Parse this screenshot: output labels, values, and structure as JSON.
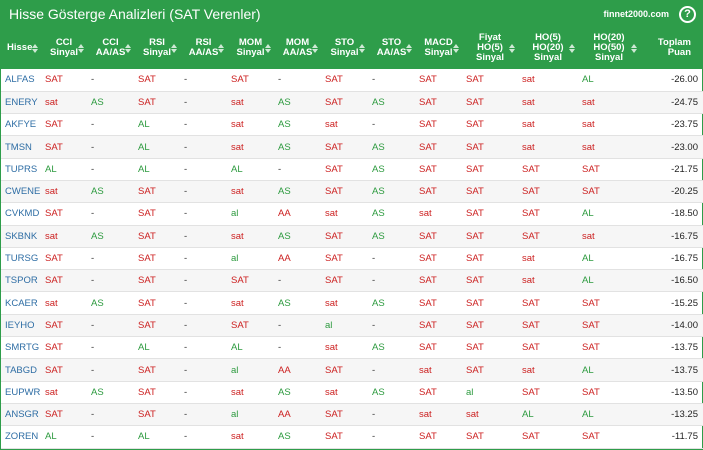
{
  "header": {
    "title": "Hisse Gösterge Analizleri (SAT Verenler)",
    "brand": "finnet2000.com",
    "help": "?"
  },
  "colors": {
    "accent": "#2e9d4a",
    "sell": "#cc1f1f",
    "buy": "#2c9a3e",
    "link": "#2e6da4"
  },
  "columns": [
    {
      "key": "hisse",
      "lines": [
        "Hisse"
      ]
    },
    {
      "key": "cci",
      "lines": [
        "CCI",
        "Sinyal"
      ]
    },
    {
      "key": "cci_aa",
      "lines": [
        "CCI",
        "AA/AS"
      ]
    },
    {
      "key": "rsi",
      "lines": [
        "RSI",
        "Sinyal"
      ]
    },
    {
      "key": "rsi_aa",
      "lines": [
        "RSI",
        "AA/AS"
      ]
    },
    {
      "key": "mom",
      "lines": [
        "MOM",
        "Sinyal"
      ]
    },
    {
      "key": "mom_aa",
      "lines": [
        "MOM",
        "AA/AS"
      ]
    },
    {
      "key": "sto",
      "lines": [
        "STO",
        "Sinyal"
      ]
    },
    {
      "key": "sto_aa",
      "lines": [
        "STO",
        "AA/AS"
      ]
    },
    {
      "key": "macd",
      "lines": [
        "MACD",
        "Sinyal"
      ]
    },
    {
      "key": "fiyat_ho5",
      "lines": [
        "Fiyat",
        "HO(5)",
        "Sinyal"
      ]
    },
    {
      "key": "ho5_20",
      "lines": [
        "HO(5)",
        "HO(20)",
        "Sinyal"
      ]
    },
    {
      "key": "ho20_50",
      "lines": [
        "HO(20)",
        "HO(50)",
        "Sinyal"
      ]
    },
    {
      "key": "puan",
      "lines": [
        "Toplam",
        "Puan"
      ]
    }
  ],
  "rows": [
    [
      "ALFAS",
      "SAT",
      "-",
      "SAT",
      "-",
      "SAT",
      "-",
      "SAT",
      "-",
      "SAT",
      "SAT",
      "sat",
      "AL",
      "-26.00"
    ],
    [
      "ENERY",
      "sat",
      "AS",
      "SAT",
      "-",
      "sat",
      "AS",
      "SAT",
      "AS",
      "SAT",
      "SAT",
      "sat",
      "sat",
      "-24.75"
    ],
    [
      "AKFYE",
      "SAT",
      "-",
      "AL",
      "-",
      "sat",
      "AS",
      "sat",
      "-",
      "SAT",
      "SAT",
      "sat",
      "sat",
      "-23.75"
    ],
    [
      "TMSN",
      "SAT",
      "-",
      "AL",
      "-",
      "sat",
      "AS",
      "SAT",
      "AS",
      "SAT",
      "SAT",
      "sat",
      "sat",
      "-23.00"
    ],
    [
      "TUPRS",
      "AL",
      "-",
      "AL",
      "-",
      "AL",
      "-",
      "SAT",
      "AS",
      "SAT",
      "SAT",
      "SAT",
      "SAT",
      "-21.75"
    ],
    [
      "CWENE",
      "sat",
      "AS",
      "SAT",
      "-",
      "sat",
      "AS",
      "SAT",
      "AS",
      "SAT",
      "SAT",
      "SAT",
      "SAT",
      "-20.25"
    ],
    [
      "CVKMD",
      "SAT",
      "-",
      "SAT",
      "-",
      "al",
      "AA",
      "sat",
      "AS",
      "sat",
      "SAT",
      "SAT",
      "AL",
      "-18.50"
    ],
    [
      "SKBNK",
      "sat",
      "AS",
      "SAT",
      "-",
      "sat",
      "AS",
      "SAT",
      "AS",
      "SAT",
      "SAT",
      "SAT",
      "sat",
      "-16.75"
    ],
    [
      "TURSG",
      "SAT",
      "-",
      "SAT",
      "-",
      "al",
      "AA",
      "SAT",
      "-",
      "SAT",
      "SAT",
      "sat",
      "AL",
      "-16.75"
    ],
    [
      "TSPOR",
      "SAT",
      "-",
      "SAT",
      "-",
      "SAT",
      "-",
      "SAT",
      "-",
      "SAT",
      "SAT",
      "sat",
      "AL",
      "-16.50"
    ],
    [
      "KCAER",
      "sat",
      "AS",
      "SAT",
      "-",
      "sat",
      "AS",
      "sat",
      "AS",
      "SAT",
      "SAT",
      "SAT",
      "SAT",
      "-15.25"
    ],
    [
      "IEYHO",
      "SAT",
      "-",
      "SAT",
      "-",
      "SAT",
      "-",
      "al",
      "-",
      "SAT",
      "SAT",
      "SAT",
      "SAT",
      "-14.00"
    ],
    [
      "SMRTG",
      "SAT",
      "-",
      "AL",
      "-",
      "AL",
      "-",
      "sat",
      "AS",
      "SAT",
      "SAT",
      "SAT",
      "SAT",
      "-13.75"
    ],
    [
      "TABGD",
      "SAT",
      "-",
      "SAT",
      "-",
      "al",
      "AA",
      "SAT",
      "-",
      "sat",
      "SAT",
      "sat",
      "AL",
      "-13.75"
    ],
    [
      "EUPWR",
      "sat",
      "AS",
      "SAT",
      "-",
      "sat",
      "AS",
      "sat",
      "AS",
      "SAT",
      "al",
      "SAT",
      "SAT",
      "-13.50"
    ],
    [
      "ANSGR",
      "SAT",
      "-",
      "SAT",
      "-",
      "al",
      "AA",
      "SAT",
      "-",
      "sat",
      "sat",
      "AL",
      "AL",
      "-13.25"
    ],
    [
      "ZOREN",
      "AL",
      "-",
      "AL",
      "-",
      "sat",
      "AS",
      "SAT",
      "-",
      "SAT",
      "SAT",
      "SAT",
      "SAT",
      "-11.75"
    ]
  ]
}
